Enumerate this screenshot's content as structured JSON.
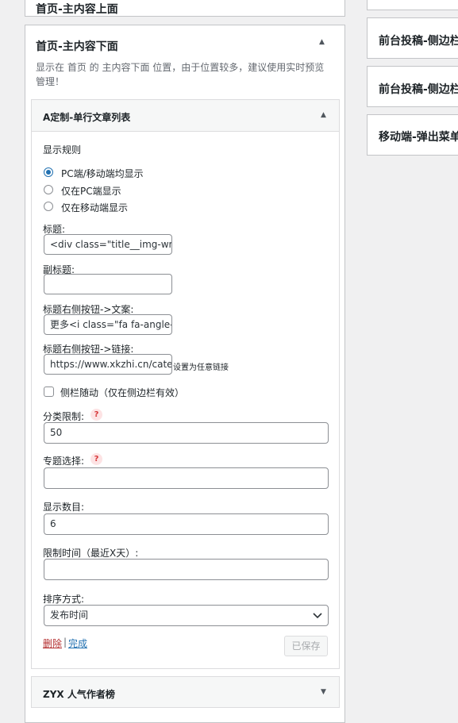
{
  "top_panel": {
    "title": "首页-主内容上面"
  },
  "main_panel": {
    "title": "首页-主内容下面",
    "desc": "显示在 首页 的 主内容下面 位置，由于位置较多，建议使用实时预览管理！"
  },
  "widget": {
    "title": "A定制-单行文章列表",
    "display_rule_label": "显示规则",
    "radio_options": [
      "PC端/移动端均显示",
      "仅在PC端显示",
      "仅在移动端显示"
    ],
    "selected_radio": 0,
    "title_label": "标题:",
    "title_value": "<div class=\"title__img-wra",
    "subtitle_label": "副标题:",
    "subtitle_value": "",
    "btn_text_label": "标题右侧按钮->文案:",
    "btn_text_value": "更多<i class=\"fa fa-angle-r",
    "btn_link_label": "标题右侧按钮->链接:",
    "btn_link_value": "https://www.xkzhi.cn/categ",
    "btn_link_hint": "设置为任意链接",
    "sidebar_follow_label": "侧栏随动（仅在侧边栏有效）",
    "category_label": "分类限制:",
    "category_value": "50",
    "topic_label": "专题选择:",
    "topic_value": "",
    "count_label": "显示数目:",
    "count_value": "6",
    "days_label": "限制时间（最近X天）:",
    "days_value": "",
    "order_label": "排序方式:",
    "order_value": "发布时间",
    "delete_label": "删除",
    "separator": "|",
    "done_label": "完成",
    "saved_label": "已保存",
    "help_glyph": "?"
  },
  "bottom_widget": {
    "title": "ZYX 人气作者榜"
  },
  "right_panels": [
    {
      "title": "前台投稿-侧边栏"
    },
    {
      "title": "前台投稿-侧边栏"
    },
    {
      "title": "移动端-弹出菜单"
    }
  ]
}
